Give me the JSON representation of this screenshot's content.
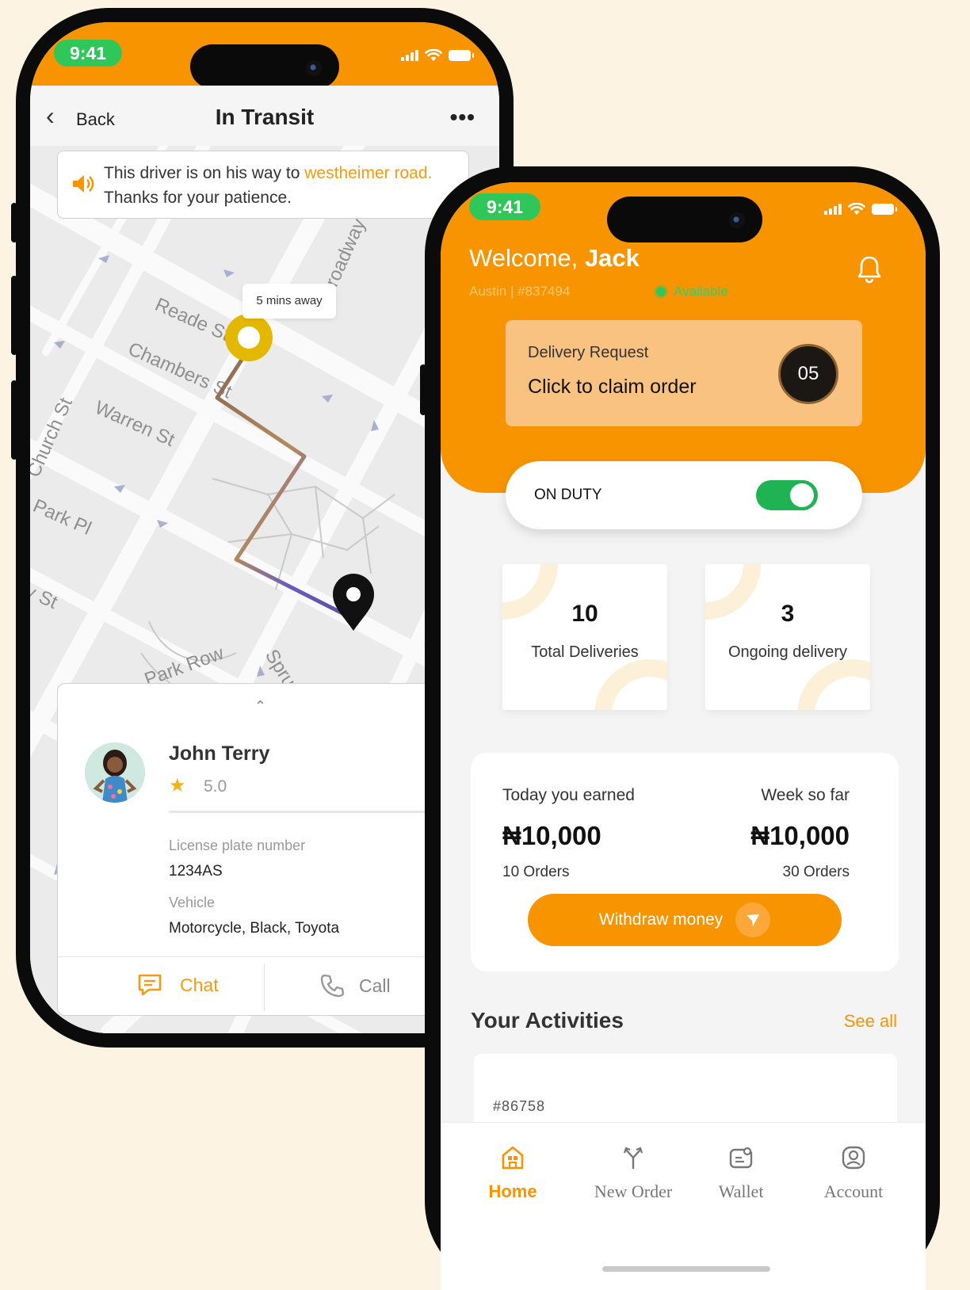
{
  "transit_screen": {
    "status_time": "9:41",
    "nav": {
      "back_label": "Back",
      "title": "In Transit",
      "more_label": "•••"
    },
    "banner": {
      "text_before": "This driver is on his way to ",
      "destination": "westheimer road.",
      "text_after": "Thanks for your patience."
    },
    "eta_label": "5 mins away",
    "map_labels": [
      "Reade St",
      "Chambers St",
      "Warren St",
      "Church St",
      "Park Pl",
      "Barclay St",
      "Park Row",
      "Spruce St",
      "Broadway"
    ],
    "driver": {
      "name": "John Terry",
      "rating": "5.0",
      "plate_label": "License plate number",
      "plate_value": "1234AS",
      "vehicle_label": "Vehicle",
      "vehicle_value": "Motorcycle, Black, Toyota"
    },
    "actions": {
      "chat_label": "Chat",
      "call_label": "Call"
    }
  },
  "dashboard_screen": {
    "status_time": "9:41",
    "welcome_prefix": "Welcome, ",
    "user_name": "Jack",
    "location_id": "Austin  |  #837494",
    "availability": "Available",
    "delivery_request": {
      "title": "Delivery Request",
      "cta": "Click to claim order",
      "count": "05"
    },
    "duty": {
      "label": "ON DUTY",
      "enabled": true
    },
    "stats": [
      {
        "value": "10",
        "label": "Total Deliveries"
      },
      {
        "value": "3",
        "label": "Ongoing delivery"
      }
    ],
    "earnings": {
      "today_label": "Today you earned",
      "today_amount": "₦10,000",
      "today_orders": "10 Orders",
      "week_label": "Week so far",
      "week_amount": "₦10,000",
      "week_orders": "30 Orders",
      "withdraw_label": "Withdraw money"
    },
    "activities": {
      "title": "Your Activities",
      "see_all": "See all",
      "first_id": "#86758"
    },
    "tabs": [
      {
        "label": "Home",
        "icon": "home-icon",
        "active": true
      },
      {
        "label": "New Order",
        "icon": "route-split-icon",
        "active": false
      },
      {
        "label": "Wallet",
        "icon": "wallet-icon",
        "active": false
      },
      {
        "label": "Account",
        "icon": "account-icon",
        "active": false
      }
    ]
  },
  "colors": {
    "brand_orange": "#F79400",
    "available_green": "#2FC75A",
    "toggle_green": "#1FB353",
    "highlight_orange": "#F39B14"
  }
}
